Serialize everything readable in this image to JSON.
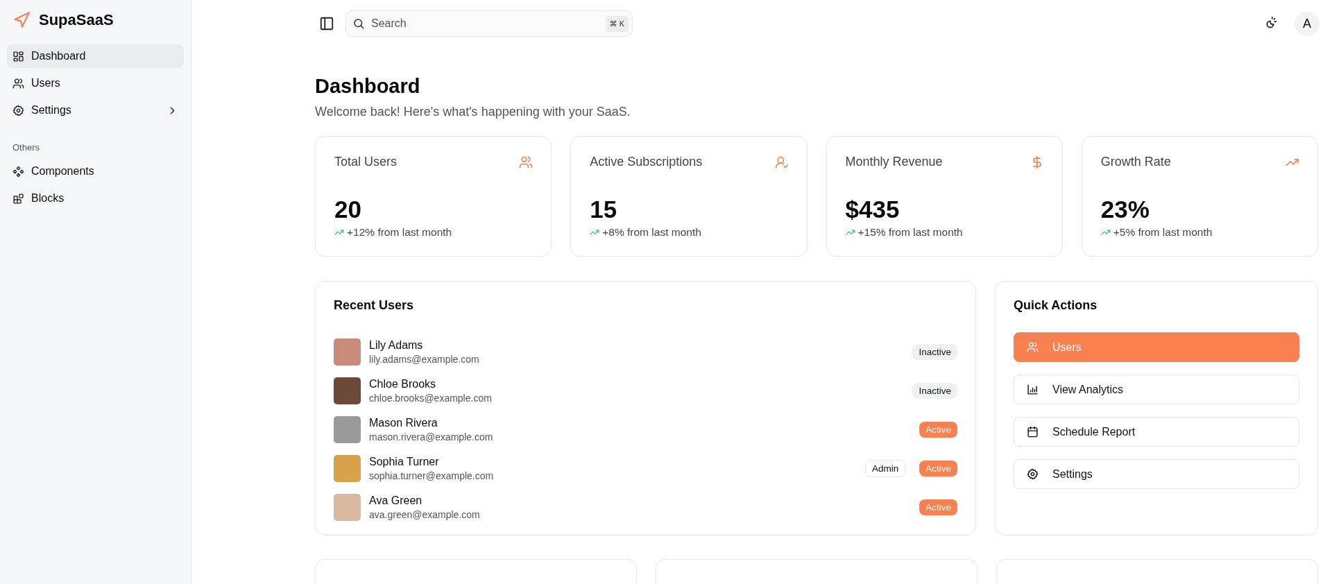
{
  "brand": {
    "name": "SupaSaaS"
  },
  "sidebar": {
    "items": [
      {
        "label": "Dashboard",
        "selected": true
      },
      {
        "label": "Users",
        "selected": false
      },
      {
        "label": "Settings",
        "selected": false,
        "expandable": true
      }
    ],
    "section_label": "Others",
    "other_items": [
      {
        "label": "Components",
        "selected": false
      },
      {
        "label": "Blocks",
        "selected": false
      }
    ]
  },
  "topbar": {
    "search": {
      "placeholder": "Search",
      "shortcut": "⌘ K"
    },
    "avatar": "A"
  },
  "header": {
    "title": "Dashboard",
    "subtitle": "Welcome back! Here's what's happening with your SaaS."
  },
  "stats": [
    {
      "label": "Total Users",
      "value": "20",
      "change": "+12% from last month"
    },
    {
      "label": "Active Subscriptions",
      "value": "15",
      "change": "+8% from last month"
    },
    {
      "label": "Monthly Revenue",
      "value": "$435",
      "change": "+15% from last month"
    },
    {
      "label": "Growth Rate",
      "value": "23%",
      "change": "+5% from last month"
    }
  ],
  "recent_users": {
    "title": "Recent Users",
    "rows": [
      {
        "name": "Lily Adams",
        "email": "lily.adams@example.com",
        "role": "",
        "status": "Inactive",
        "kind": "inactive"
      },
      {
        "name": "Chloe Brooks",
        "email": "chloe.brooks@example.com",
        "role": "",
        "status": "Inactive",
        "kind": "inactive"
      },
      {
        "name": "Mason Rivera",
        "email": "mason.rivera@example.com",
        "role": "",
        "status": "Active",
        "kind": "active"
      },
      {
        "name": "Sophia Turner",
        "email": "sophia.turner@example.com",
        "role": "Admin",
        "status": "Active",
        "kind": "active"
      },
      {
        "name": "Ava Green",
        "email": "ava.green@example.com",
        "role": "",
        "status": "Active",
        "kind": "active"
      }
    ]
  },
  "quick_actions": {
    "title": "Quick Actions",
    "buttons": [
      {
        "label": "Users",
        "selected": true
      },
      {
        "label": "View Analytics",
        "selected": false
      },
      {
        "label": "Schedule Report",
        "selected": false
      },
      {
        "label": "Settings",
        "selected": false
      }
    ]
  }
}
